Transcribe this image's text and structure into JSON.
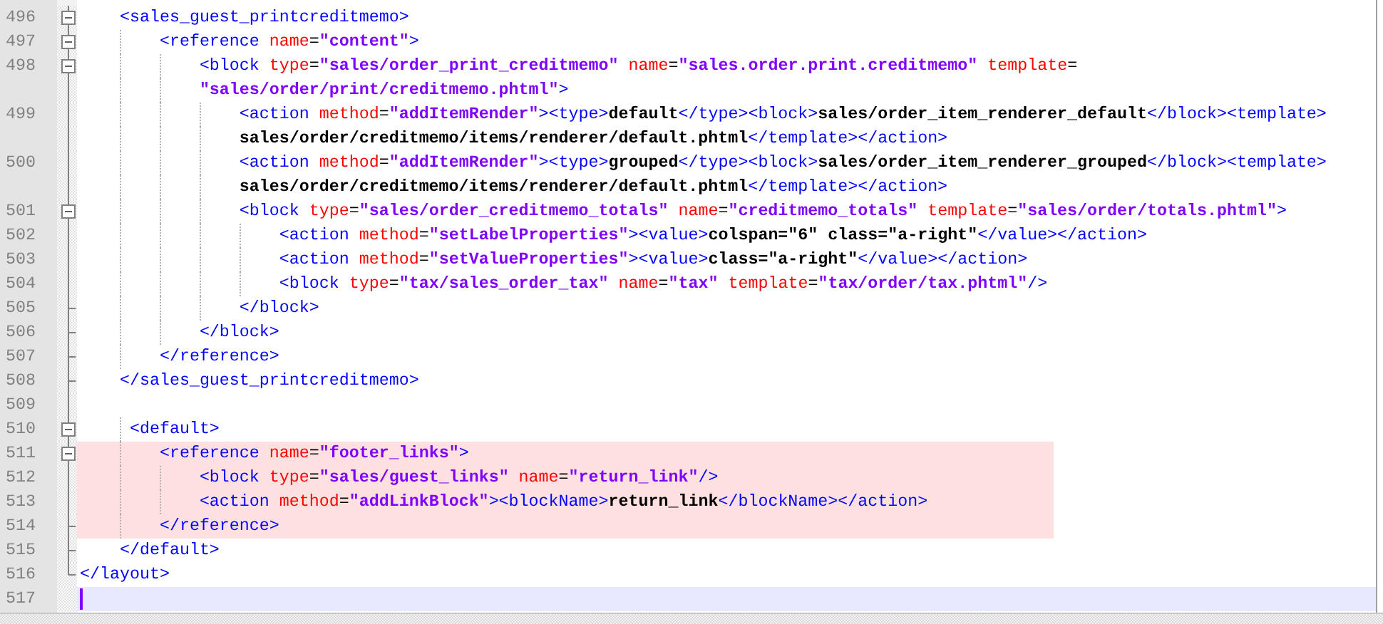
{
  "editor": {
    "lines": [
      {
        "number": "496",
        "kind": "fold-start",
        "highlighted": false,
        "current": false,
        "code": [
          {
            "kind": "tag",
            "text": "    <sales_guest_printcreditmemo>"
          }
        ]
      },
      {
        "number": "497",
        "kind": "fold-start",
        "highlighted": false,
        "current": false,
        "code": [
          {
            "kind": "tag",
            "text": "        <reference"
          },
          {
            "kind": "attr",
            "text": " name"
          },
          {
            "kind": "eq",
            "text": "="
          },
          {
            "kind": "value",
            "text": "\"content\""
          },
          {
            "kind": "tag",
            "text": ">"
          }
        ]
      },
      {
        "number": "498",
        "kind": "fold-start",
        "highlighted": false,
        "current": false,
        "code": [
          {
            "kind": "tag",
            "text": "            <block"
          },
          {
            "kind": "attr",
            "text": " type"
          },
          {
            "kind": "eq",
            "text": "="
          },
          {
            "kind": "value",
            "text": "\"sales/order_print_creditmemo\""
          },
          {
            "kind": "attr",
            "text": " name"
          },
          {
            "kind": "eq",
            "text": "="
          },
          {
            "kind": "value",
            "text": "\"sales.order.print.creditmemo\""
          },
          {
            "kind": "attr",
            "text": " template"
          },
          {
            "kind": "eq",
            "text": "="
          }
        ],
        "continuation": [
          {
            "kind": "value",
            "text": "\"sales/order/print/creditmemo.phtml\""
          },
          {
            "kind": "tag",
            "text": ">"
          }
        ]
      },
      {
        "number": "499",
        "kind": "fold-body",
        "highlighted": false,
        "current": false,
        "code": [
          {
            "kind": "tag",
            "text": "                <action"
          },
          {
            "kind": "attr",
            "text": " method"
          },
          {
            "kind": "eq",
            "text": "="
          },
          {
            "kind": "value",
            "text": "\"addItemRender\""
          },
          {
            "kind": "tag",
            "text": "><type>"
          },
          {
            "kind": "text",
            "text": "default"
          },
          {
            "kind": "tag",
            "text": "</type><block>"
          },
          {
            "kind": "text",
            "text": "sales/order_item_renderer_default"
          },
          {
            "kind": "tag",
            "text": "</block><template>"
          }
        ],
        "continuation": [
          {
            "kind": "text",
            "text": "sales/order/creditmemo/items/renderer/default.phtml"
          },
          {
            "kind": "tag",
            "text": "</template></action>"
          }
        ]
      },
      {
        "number": "500",
        "kind": "fold-body",
        "highlighted": false,
        "current": false,
        "code": [
          {
            "kind": "tag",
            "text": "                <action"
          },
          {
            "kind": "attr",
            "text": " method"
          },
          {
            "kind": "eq",
            "text": "="
          },
          {
            "kind": "value",
            "text": "\"addItemRender\""
          },
          {
            "kind": "tag",
            "text": "><type>"
          },
          {
            "kind": "text",
            "text": "grouped"
          },
          {
            "kind": "tag",
            "text": "</type><block>"
          },
          {
            "kind": "text",
            "text": "sales/order_item_renderer_grouped"
          },
          {
            "kind": "tag",
            "text": "</block><template>"
          }
        ],
        "continuation": [
          {
            "kind": "text",
            "text": "sales/order/creditmemo/items/renderer/default.phtml"
          },
          {
            "kind": "tag",
            "text": "</template></action>"
          }
        ]
      },
      {
        "number": "501",
        "kind": "fold-start",
        "highlighted": false,
        "current": false,
        "code": [
          {
            "kind": "tag",
            "text": "                <block"
          },
          {
            "kind": "attr",
            "text": " type"
          },
          {
            "kind": "eq",
            "text": "="
          },
          {
            "kind": "value",
            "text": "\"sales/order_creditmemo_totals\""
          },
          {
            "kind": "attr",
            "text": " name"
          },
          {
            "kind": "eq",
            "text": "="
          },
          {
            "kind": "value",
            "text": "\"creditmemo_totals\""
          },
          {
            "kind": "attr",
            "text": " template"
          },
          {
            "kind": "eq",
            "text": "="
          },
          {
            "kind": "value",
            "text": "\"sales/order/totals.phtml\""
          },
          {
            "kind": "tag",
            "text": ">"
          }
        ]
      },
      {
        "number": "502",
        "kind": "fold-body",
        "highlighted": false,
        "current": false,
        "code": [
          {
            "kind": "tag",
            "text": "                    <action"
          },
          {
            "kind": "attr",
            "text": " method"
          },
          {
            "kind": "eq",
            "text": "="
          },
          {
            "kind": "value",
            "text": "\"setLabelProperties\""
          },
          {
            "kind": "tag",
            "text": "><value>"
          },
          {
            "kind": "text",
            "text": "colspan=\"6\" class=\"a-right\""
          },
          {
            "kind": "tag",
            "text": "</value></action>"
          }
        ]
      },
      {
        "number": "503",
        "kind": "fold-body",
        "highlighted": false,
        "current": false,
        "code": [
          {
            "kind": "tag",
            "text": "                    <action"
          },
          {
            "kind": "attr",
            "text": " method"
          },
          {
            "kind": "eq",
            "text": "="
          },
          {
            "kind": "value",
            "text": "\"setValueProperties\""
          },
          {
            "kind": "tag",
            "text": "><value>"
          },
          {
            "kind": "text",
            "text": "class=\"a-right\""
          },
          {
            "kind": "tag",
            "text": "</value></action>"
          }
        ]
      },
      {
        "number": "504",
        "kind": "fold-body",
        "highlighted": false,
        "current": false,
        "code": [
          {
            "kind": "tag",
            "text": "                    <block"
          },
          {
            "kind": "attr",
            "text": " type"
          },
          {
            "kind": "eq",
            "text": "="
          },
          {
            "kind": "value",
            "text": "\"tax/sales_order_tax\""
          },
          {
            "kind": "attr",
            "text": " name"
          },
          {
            "kind": "eq",
            "text": "="
          },
          {
            "kind": "value",
            "text": "\"tax\""
          },
          {
            "kind": "attr",
            "text": " template"
          },
          {
            "kind": "eq",
            "text": "="
          },
          {
            "kind": "value",
            "text": "\"tax/order/tax.phtml\""
          },
          {
            "kind": "tag",
            "text": "/>"
          }
        ]
      },
      {
        "number": "505",
        "kind": "fold-end",
        "highlighted": false,
        "current": false,
        "code": [
          {
            "kind": "tag",
            "text": "                </block>"
          }
        ]
      },
      {
        "number": "506",
        "kind": "fold-end",
        "highlighted": false,
        "current": false,
        "code": [
          {
            "kind": "tag",
            "text": "            </block>"
          }
        ]
      },
      {
        "number": "507",
        "kind": "fold-end",
        "highlighted": false,
        "current": false,
        "code": [
          {
            "kind": "tag",
            "text": "        </reference>"
          }
        ]
      },
      {
        "number": "508",
        "kind": "fold-end",
        "highlighted": false,
        "current": false,
        "code": [
          {
            "kind": "tag",
            "text": "    </sales_guest_printcreditmemo>"
          }
        ]
      },
      {
        "number": "509",
        "kind": "fold-body",
        "highlighted": false,
        "current": false
      },
      {
        "number": "510",
        "kind": "fold-start",
        "highlighted": false,
        "current": false,
        "code": [
          {
            "kind": "tag",
            "text": "     <default>"
          }
        ]
      },
      {
        "number": "511",
        "kind": "fold-start",
        "highlighted": true,
        "current": false,
        "code": [
          {
            "kind": "tag",
            "text": "        <reference"
          },
          {
            "kind": "attr",
            "text": " name"
          },
          {
            "kind": "eq",
            "text": "="
          },
          {
            "kind": "value",
            "text": "\"footer_links\""
          },
          {
            "kind": "tag",
            "text": ">"
          }
        ]
      },
      {
        "number": "512",
        "kind": "fold-body",
        "highlighted": true,
        "current": false,
        "code": [
          {
            "kind": "tag",
            "text": "            <block"
          },
          {
            "kind": "attr",
            "text": " type"
          },
          {
            "kind": "eq",
            "text": "="
          },
          {
            "kind": "value",
            "text": "\"sales/guest_links\""
          },
          {
            "kind": "attr",
            "text": " name"
          },
          {
            "kind": "eq",
            "text": "="
          },
          {
            "kind": "value",
            "text": "\"return_link\""
          },
          {
            "kind": "tag",
            "text": "/>"
          }
        ]
      },
      {
        "number": "513",
        "kind": "fold-body",
        "highlighted": true,
        "current": false,
        "code": [
          {
            "kind": "tag",
            "text": "            <action"
          },
          {
            "kind": "attr",
            "text": " method"
          },
          {
            "kind": "eq",
            "text": "="
          },
          {
            "kind": "value",
            "text": "\"addLinkBlock\""
          },
          {
            "kind": "tag",
            "text": "><blockName>"
          },
          {
            "kind": "text",
            "text": "return_link"
          },
          {
            "kind": "tag",
            "text": "</blockName></action>"
          }
        ]
      },
      {
        "number": "514",
        "kind": "fold-end",
        "highlighted": true,
        "current": false,
        "code": [
          {
            "kind": "tag",
            "text": "        </reference>"
          }
        ]
      },
      {
        "number": "515",
        "kind": "fold-end",
        "highlighted": false,
        "current": false,
        "code": [
          {
            "kind": "tag",
            "text": "    </default>"
          }
        ]
      },
      {
        "number": "516",
        "kind": "fold-last",
        "highlighted": false,
        "current": false,
        "code": [
          {
            "kind": "tag",
            "text": "</layout>"
          }
        ]
      },
      {
        "number": "517",
        "kind": "plain",
        "highlighted": false,
        "current": true
      }
    ]
  }
}
